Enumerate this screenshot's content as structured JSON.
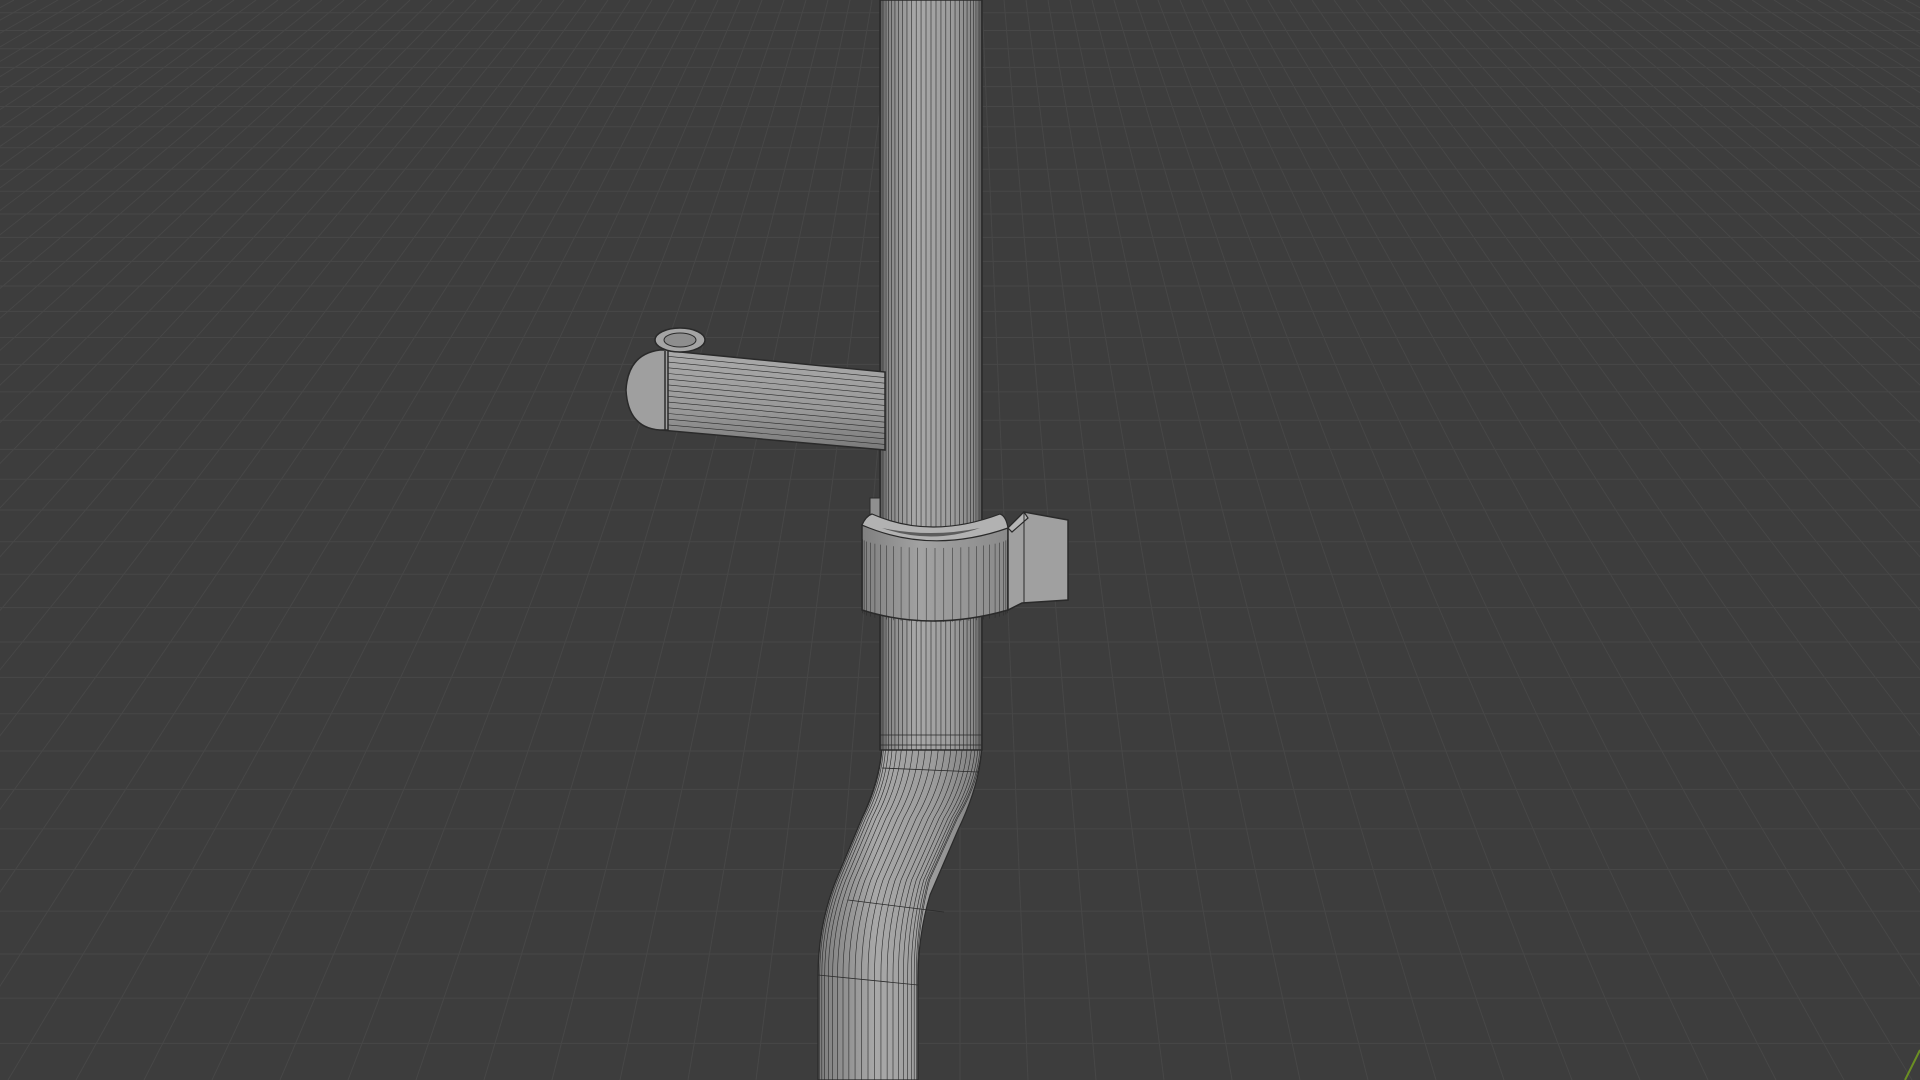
{
  "viewport": {
    "kind": "3d-viewport",
    "shading": "solid-wireframe-overlay",
    "colors": {
      "background": "#3d3d3d",
      "grid_line": "#474747",
      "grid_major": "#4f4f4f",
      "mesh_fill": "#9a9a9a",
      "mesh_wire": "#2a2a2a",
      "axis_y": "#6b8f23"
    },
    "objects": [
      {
        "name": "vertical-pipe"
      },
      {
        "name": "side-branch-pipe"
      },
      {
        "name": "pipe-end-cap"
      },
      {
        "name": "pipe-clamp"
      },
      {
        "name": "clamp-tab"
      },
      {
        "name": "offset-bend-pipe"
      }
    ]
  }
}
